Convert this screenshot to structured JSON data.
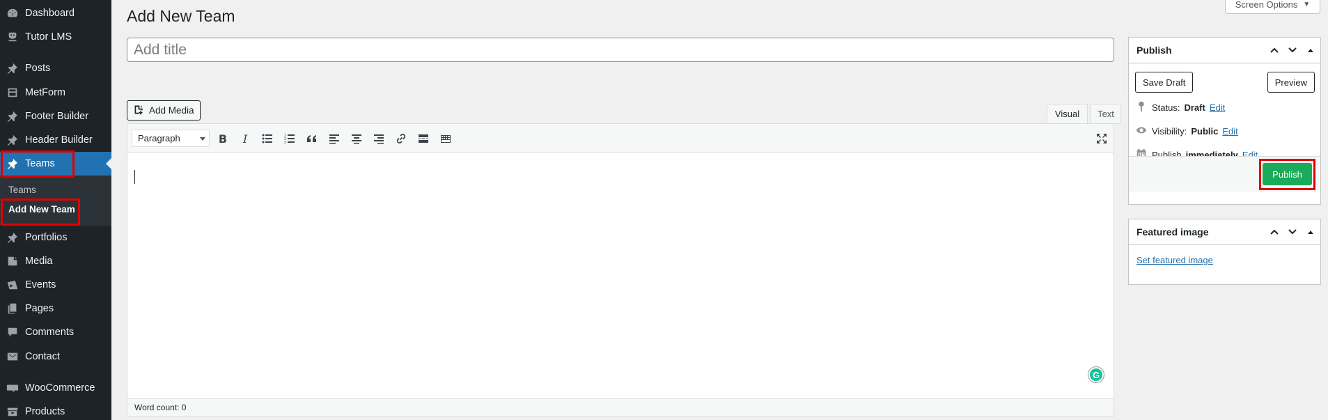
{
  "sidebar": {
    "items": [
      {
        "label": "Dashboard",
        "icon": "dashboard-icon"
      },
      {
        "label": "Tutor LMS",
        "icon": "tutor-icon"
      },
      {
        "label": "Posts",
        "icon": "pin-icon"
      },
      {
        "label": "MetForm",
        "icon": "form-icon"
      },
      {
        "label": "Footer Builder",
        "icon": "pin-icon"
      },
      {
        "label": "Header Builder",
        "icon": "pin-icon"
      },
      {
        "label": "Teams",
        "icon": "pin-icon"
      },
      {
        "label": "Portfolios",
        "icon": "pin-icon"
      },
      {
        "label": "Media",
        "icon": "media-icon"
      },
      {
        "label": "Events",
        "icon": "events-icon"
      },
      {
        "label": "Pages",
        "icon": "pages-icon"
      },
      {
        "label": "Comments",
        "icon": "comments-icon"
      },
      {
        "label": "Contact",
        "icon": "mail-icon"
      },
      {
        "label": "WooCommerce",
        "icon": "woo-icon"
      },
      {
        "label": "Products",
        "icon": "products-icon"
      }
    ],
    "submenu": {
      "teams": "Teams",
      "add_new": "Add New Team"
    }
  },
  "header": {
    "screen_options": "Screen Options",
    "page_title": "Add New Team"
  },
  "editor": {
    "title_placeholder": "Add title",
    "add_media": "Add Media",
    "tab_visual": "Visual",
    "tab_text": "Text",
    "format": "Paragraph",
    "word_count": "Word count: 0"
  },
  "publish_box": {
    "title": "Publish",
    "save_draft": "Save Draft",
    "preview": "Preview",
    "status_label": "Status:",
    "status_value": "Draft",
    "visibility_label": "Visibility:",
    "visibility_value": "Public",
    "publish_label": "Publish",
    "publish_value": "immediately",
    "edit": "Edit",
    "publish_button": "Publish"
  },
  "featured_box": {
    "title": "Featured image",
    "set_link": "Set featured image"
  },
  "colors": {
    "sidebar": "#1d2327",
    "active": "#2271b1",
    "publish": "#1aab5a",
    "highlight": "#e00000"
  }
}
